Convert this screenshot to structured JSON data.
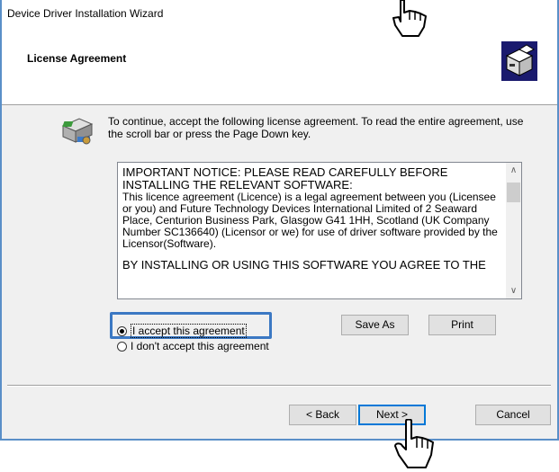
{
  "window": {
    "title": "Device Driver Installation Wizard",
    "header_title": "License Agreement"
  },
  "intro_text": "To continue, accept the following license agreement. To read the entire agreement, use the scroll bar or press the Page Down key.",
  "license": {
    "heading_line1": "IMPORTANT NOTICE: PLEASE READ CAREFULLY BEFORE",
    "heading_line2": "INSTALLING THE RELEVANT SOFTWARE:",
    "body": "This licence agreement (Licence) is a legal agreement between you (Licensee or you) and Future Technology Devices International Limited of 2 Seaward Place, Centurion Business Park, Glasgow G41 1HH, Scotland (UK Company Number SC136640) (Licensor or we) for use of driver software provided by the Licensor(Software).",
    "last_line": "BY INSTALLING OR USING THIS SOFTWARE YOU AGREE TO THE"
  },
  "options": {
    "accept_label": "I accept this agreement",
    "decline_label": "I don't accept this agreement",
    "selected": "accept"
  },
  "buttons": {
    "save_as": "Save As",
    "print": "Print",
    "back": "< Back",
    "next": "Next >",
    "cancel": "Cancel"
  },
  "icons": {
    "header": "installer-box-icon",
    "body": "license-document-icon",
    "cursor": "hand-pointer-icon"
  },
  "colors": {
    "focus_frame": "#3b78c3",
    "default_button_border": "#0078d7",
    "window_border": "#5a8fc8"
  }
}
